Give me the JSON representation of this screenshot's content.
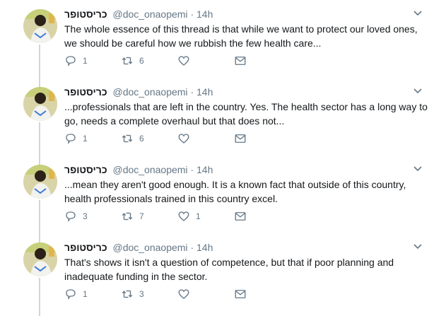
{
  "colors": {
    "text": "#14171a",
    "secondary": "#657786",
    "thread_line": "#ccd6dd",
    "icon": "#657786"
  },
  "tweets": [
    {
      "author_name": "כריסטופר",
      "handle": "@doc_onaopemi",
      "separator": "·",
      "time": "14h",
      "text": "The whole essence of this thread is that while we want to protect our loved ones, we should be careful how we rubbish the few health care...",
      "replies": "1",
      "retweets": "6",
      "likes": ""
    },
    {
      "author_name": "כריסטופר",
      "handle": "@doc_onaopemi",
      "separator": "·",
      "time": "14h",
      "text": "...professionals that are left in the country. Yes. The health sector has a long way to go, needs a complete overhaul but that does not...",
      "replies": "1",
      "retweets": "6",
      "likes": ""
    },
    {
      "author_name": "כריסטופר",
      "handle": "@doc_onaopemi",
      "separator": "·",
      "time": "14h",
      "text": "...mean they aren't good enough. It is a known fact that outside of this country, health professionals trained in this country excel.",
      "replies": "3",
      "retweets": "7",
      "likes": "1"
    },
    {
      "author_name": "כריסטופר",
      "handle": "@doc_onaopemi",
      "separator": "·",
      "time": "14h",
      "text": "That's shows it isn't a question of competence, but that if poor planning and inadequate funding in the sector.",
      "replies": "1",
      "retweets": "3",
      "likes": ""
    }
  ]
}
